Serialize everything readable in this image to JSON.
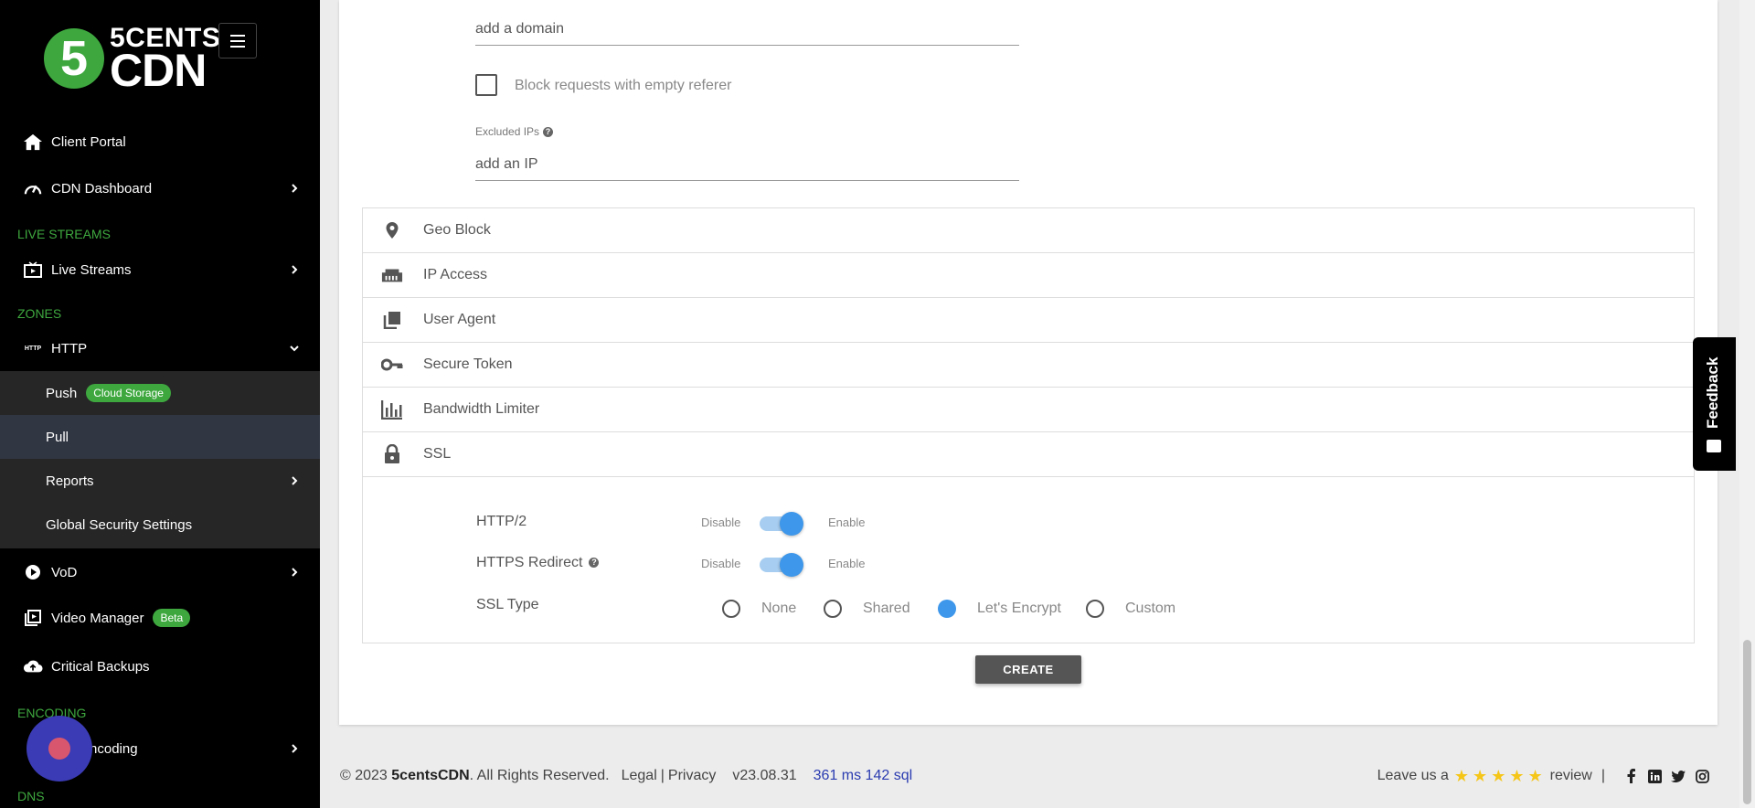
{
  "brand": {
    "digit": "5",
    "line1": "5CENTS",
    "line2": "CDN"
  },
  "sidebar": {
    "client_portal": "Client Portal",
    "cdn_dashboard": "CDN Dashboard",
    "section_live": "LIVE STREAMS",
    "live_streams": "Live Streams",
    "section_zones": "ZONES",
    "http_icon_text": "HTTP",
    "http": "HTTP",
    "push": "Push",
    "push_badge": "Cloud Storage",
    "pull": "Pull",
    "reports": "Reports",
    "global_security": "Global Security Settings",
    "vod": "VoD",
    "video_manager": "Video Manager",
    "video_manager_badge": "Beta",
    "critical_backups": "Critical Backups",
    "section_encoding": "ENCODING",
    "encoding": "Encoding",
    "section_dns": "DNS"
  },
  "form": {
    "domain_placeholder": "add a domain",
    "block_empty_referer": "Block requests with empty referer",
    "excluded_ips_label": "Excluded IPs",
    "ip_placeholder": "add an IP"
  },
  "accordion": {
    "geo_block": "Geo Block",
    "ip_access": "IP Access",
    "user_agent": "User Agent",
    "secure_token": "Secure Token",
    "bandwidth_limiter": "Bandwidth Limiter",
    "ssl": "SSL"
  },
  "ssl": {
    "http2_label": "HTTP/2",
    "https_redirect_label": "HTTPS Redirect",
    "disable": "Disable",
    "enable": "Enable",
    "http2_enabled": true,
    "https_redirect_enabled": true,
    "ssl_type_label": "SSL Type",
    "options": [
      "None",
      "Shared",
      "Let's Encrypt",
      "Custom"
    ],
    "selected": "Let's Encrypt"
  },
  "create_button": "CREATE",
  "feedback": "Feedback",
  "footer": {
    "copyright": "© 2023",
    "company": "5centsCDN",
    "rights": ". All Rights Reserved.",
    "legal": "Legal",
    "sep": "|",
    "privacy": "Privacy",
    "version": "v23.08.31",
    "perf": "361 ms 142 sql",
    "leave": "Leave us a",
    "review": "review",
    "rating": 5
  },
  "colors": {
    "accent_green": "#3ea83f",
    "toggle_blue": "#3e97ea",
    "sidebar_bg": "#000000",
    "star": "#f5c518"
  }
}
